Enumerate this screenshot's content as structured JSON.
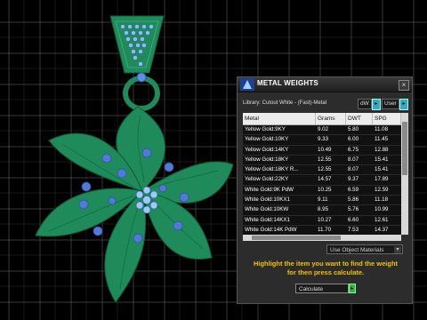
{
  "window": {
    "title": "METAL WEIGHTS",
    "close_label": "×"
  },
  "library": {
    "label": "Library: Cutout White - (Fast)-Metal"
  },
  "units": {
    "selected": "dW",
    "user_label": "User"
  },
  "table": {
    "columns": [
      "Metal",
      "Grams",
      "DWT",
      "SPG"
    ],
    "rows": [
      [
        "Yellow Gold:9KY",
        "9.02",
        "5.80",
        "11.08"
      ],
      [
        "Yellow Gold:10KY",
        "9.33",
        "6.00",
        "11.45"
      ],
      [
        "Yellow Gold:14KY",
        "10.49",
        "6.75",
        "12.88"
      ],
      [
        "Yellow Gold:18KY",
        "12.55",
        "8.07",
        "15.41"
      ],
      [
        "Yellow Gold:18KY R...",
        "12.55",
        "8.07",
        "15.41"
      ],
      [
        "Yellow Gold:22KY",
        "14.57",
        "9.37",
        "17.89"
      ],
      [
        "White Gold:9K PdW",
        "10.25",
        "6.59",
        "12.59"
      ],
      [
        "White Gold:10KX1",
        "9.11",
        "5.86",
        "11.18"
      ],
      [
        "White Gold:10KW",
        "8.95",
        "5.76",
        "10.99"
      ],
      [
        "White Gold:14KX1",
        "10.27",
        "6.60",
        "12.61"
      ],
      [
        "White Gold:14K PdW",
        "11.70",
        "7.53",
        "14.37"
      ]
    ]
  },
  "materials": {
    "selected": "Use Object Materials"
  },
  "instructions": {
    "line1": "Highlight the item you want to find the weight",
    "line2": "for then press calculate."
  },
  "calculate": {
    "selected": "Calculate",
    "button_label": "▸"
  },
  "colors": {
    "metal_green": "#1f8a5a",
    "gem_blue": "#4f7bd6",
    "accent_yellow": "#f2c200",
    "grid": "#8a8a8a"
  }
}
